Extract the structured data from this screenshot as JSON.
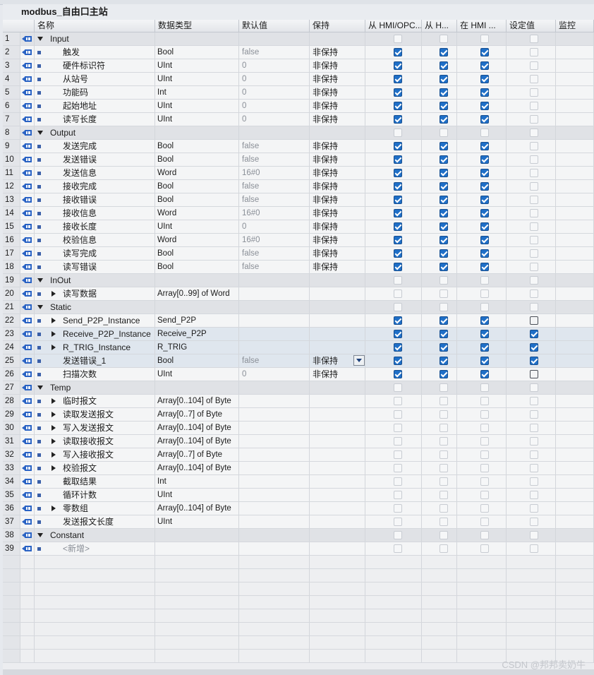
{
  "block_title": "modbus_自由口主站",
  "headers": [
    "名称",
    "数据类型",
    "默认值",
    "保持",
    "从 HMI/OPC...",
    "从 H...",
    "在 HMI ...",
    "设定值",
    "监控"
  ],
  "rows": [
    {
      "n": "1",
      "kind": "sec",
      "name": "Input",
      "caret": "down",
      "indent": 0,
      "type": "",
      "def": "",
      "ret": "",
      "cbs": [
        "off",
        "off",
        "off",
        "off"
      ]
    },
    {
      "n": "2",
      "kind": "norm",
      "name": "触发",
      "indent": 1,
      "type": "Bool",
      "def": "false",
      "ret": "非保持",
      "cbs": [
        "on",
        "on",
        "on",
        "off"
      ]
    },
    {
      "n": "3",
      "kind": "norm",
      "name": "硬件标识符",
      "indent": 1,
      "type": "UInt",
      "def": "0",
      "ret": "非保持",
      "cbs": [
        "on",
        "on",
        "on",
        "off"
      ]
    },
    {
      "n": "4",
      "kind": "norm",
      "name": "从站号",
      "indent": 1,
      "type": "UInt",
      "def": "0",
      "ret": "非保持",
      "cbs": [
        "on",
        "on",
        "on",
        "off"
      ]
    },
    {
      "n": "5",
      "kind": "norm",
      "name": "功能码",
      "indent": 1,
      "type": "Int",
      "def": "0",
      "ret": "非保持",
      "cbs": [
        "on",
        "on",
        "on",
        "off"
      ]
    },
    {
      "n": "6",
      "kind": "norm",
      "name": "起始地址",
      "indent": 1,
      "type": "UInt",
      "def": "0",
      "ret": "非保持",
      "cbs": [
        "on",
        "on",
        "on",
        "off"
      ]
    },
    {
      "n": "7",
      "kind": "norm",
      "name": "读写长度",
      "indent": 1,
      "type": "UInt",
      "def": "0",
      "ret": "非保持",
      "cbs": [
        "on",
        "on",
        "on",
        "off"
      ]
    },
    {
      "n": "8",
      "kind": "sec",
      "name": "Output",
      "caret": "down",
      "indent": 0,
      "type": "",
      "def": "",
      "ret": "",
      "cbs": [
        "off",
        "off",
        "off",
        "off"
      ]
    },
    {
      "n": "9",
      "kind": "norm",
      "name": "发送完成",
      "indent": 1,
      "type": "Bool",
      "def": "false",
      "ret": "非保持",
      "cbs": [
        "on",
        "on",
        "on",
        "off"
      ]
    },
    {
      "n": "10",
      "kind": "norm",
      "name": "发送错误",
      "indent": 1,
      "type": "Bool",
      "def": "false",
      "ret": "非保持",
      "cbs": [
        "on",
        "on",
        "on",
        "off"
      ]
    },
    {
      "n": "11",
      "kind": "norm",
      "name": "发送信息",
      "indent": 1,
      "type": "Word",
      "def": "16#0",
      "ret": "非保持",
      "cbs": [
        "on",
        "on",
        "on",
        "off"
      ]
    },
    {
      "n": "12",
      "kind": "norm",
      "name": "接收完成",
      "indent": 1,
      "type": "Bool",
      "def": "false",
      "ret": "非保持",
      "cbs": [
        "on",
        "on",
        "on",
        "off"
      ]
    },
    {
      "n": "13",
      "kind": "norm",
      "name": "接收错误",
      "indent": 1,
      "type": "Bool",
      "def": "false",
      "ret": "非保持",
      "cbs": [
        "on",
        "on",
        "on",
        "off"
      ]
    },
    {
      "n": "14",
      "kind": "norm",
      "name": "接收信息",
      "indent": 1,
      "type": "Word",
      "def": "16#0",
      "ret": "非保持",
      "cbs": [
        "on",
        "on",
        "on",
        "off"
      ]
    },
    {
      "n": "15",
      "kind": "norm",
      "name": "接收长度",
      "indent": 1,
      "type": "UInt",
      "def": "0",
      "ret": "非保持",
      "cbs": [
        "on",
        "on",
        "on",
        "off"
      ]
    },
    {
      "n": "16",
      "kind": "norm",
      "name": "校验信息",
      "indent": 1,
      "type": "Word",
      "def": "16#0",
      "ret": "非保持",
      "cbs": [
        "on",
        "on",
        "on",
        "off"
      ]
    },
    {
      "n": "17",
      "kind": "norm",
      "name": "读写完成",
      "indent": 1,
      "type": "Bool",
      "def": "false",
      "ret": "非保持",
      "cbs": [
        "on",
        "on",
        "on",
        "off"
      ]
    },
    {
      "n": "18",
      "kind": "norm",
      "name": "读写错误",
      "indent": 1,
      "type": "Bool",
      "def": "false",
      "ret": "非保持",
      "cbs": [
        "on",
        "on",
        "on",
        "off"
      ]
    },
    {
      "n": "19",
      "kind": "sec",
      "name": "InOut",
      "caret": "down",
      "indent": 0,
      "type": "",
      "def": "",
      "ret": "",
      "cbs": [
        "off",
        "off",
        "off",
        "off"
      ]
    },
    {
      "n": "20",
      "kind": "norm",
      "name": "读写数据",
      "caret": "right",
      "indent": 1,
      "type": "Array[0..99] of Word",
      "def": "",
      "ret": "",
      "cbs": [
        "off",
        "off",
        "off",
        "off"
      ]
    },
    {
      "n": "21",
      "kind": "sec",
      "name": "Static",
      "caret": "down",
      "indent": 0,
      "type": "",
      "def": "",
      "ret": "",
      "cbs": [
        "off",
        "off",
        "off",
        "off"
      ]
    },
    {
      "n": "22",
      "kind": "norm",
      "name": "Send_P2P_Instance",
      "caret": "right",
      "indent": 1,
      "type": "Send_P2P",
      "def": "",
      "ret": "",
      "cbs": [
        "on",
        "on",
        "on",
        "offdark"
      ]
    },
    {
      "n": "23",
      "kind": "sel",
      "name": "Receive_P2P_Instance",
      "caret": "right",
      "indent": 1,
      "type": "Receive_P2P",
      "def": "",
      "ret": "",
      "cbs": [
        "on",
        "on",
        "on",
        "on"
      ]
    },
    {
      "n": "24",
      "kind": "sel",
      "name": "R_TRIG_Instance",
      "caret": "right",
      "indent": 1,
      "type": "R_TRIG",
      "def": "",
      "ret": "",
      "cbs": [
        "on",
        "on",
        "on",
        "on"
      ]
    },
    {
      "n": "25",
      "kind": "sel",
      "name": "发送错误_1",
      "indent": 1,
      "type": "Bool",
      "def": "false",
      "ret": "非保持",
      "cbs": [
        "on",
        "on",
        "on",
        "on"
      ],
      "listbtn": true,
      "ddbtn": true
    },
    {
      "n": "26",
      "kind": "norm",
      "name": "扫描次数",
      "indent": 1,
      "type": "UInt",
      "def": "0",
      "ret": "非保持",
      "cbs": [
        "on",
        "on",
        "on",
        "offdark"
      ]
    },
    {
      "n": "27",
      "kind": "sec",
      "name": "Temp",
      "caret": "down",
      "indent": 0,
      "type": "",
      "def": "",
      "ret": "",
      "cbs": [
        "off",
        "off",
        "off",
        "off"
      ]
    },
    {
      "n": "28",
      "kind": "norm",
      "name": "临时报文",
      "caret": "right",
      "indent": 1,
      "type": "Array[0..104] of Byte",
      "def": "",
      "ret": "",
      "cbs": [
        "off",
        "off",
        "off",
        "off"
      ]
    },
    {
      "n": "29",
      "kind": "norm",
      "name": "读取发送报文",
      "caret": "right",
      "indent": 1,
      "type": "Array[0..7] of Byte",
      "def": "",
      "ret": "",
      "cbs": [
        "off",
        "off",
        "off",
        "off"
      ]
    },
    {
      "n": "30",
      "kind": "norm",
      "name": "写入发送报文",
      "caret": "right",
      "indent": 1,
      "type": "Array[0..104] of Byte",
      "def": "",
      "ret": "",
      "cbs": [
        "off",
        "off",
        "off",
        "off"
      ]
    },
    {
      "n": "31",
      "kind": "norm",
      "name": "读取接收报文",
      "caret": "right",
      "indent": 1,
      "type": "Array[0..104] of Byte",
      "def": "",
      "ret": "",
      "cbs": [
        "off",
        "off",
        "off",
        "off"
      ]
    },
    {
      "n": "32",
      "kind": "norm",
      "name": "写入接收报文",
      "caret": "right",
      "indent": 1,
      "type": "Array[0..7] of Byte",
      "def": "",
      "ret": "",
      "cbs": [
        "off",
        "off",
        "off",
        "off"
      ]
    },
    {
      "n": "33",
      "kind": "norm",
      "name": "校验报文",
      "caret": "right",
      "indent": 1,
      "type": "Array[0..104] of Byte",
      "def": "",
      "ret": "",
      "cbs": [
        "off",
        "off",
        "off",
        "off"
      ]
    },
    {
      "n": "34",
      "kind": "norm",
      "name": "截取结果",
      "indent": 1,
      "type": "Int",
      "def": "",
      "ret": "",
      "cbs": [
        "off",
        "off",
        "off",
        "off"
      ]
    },
    {
      "n": "35",
      "kind": "norm",
      "name": "循环计数",
      "indent": 1,
      "type": "UInt",
      "def": "",
      "ret": "",
      "cbs": [
        "off",
        "off",
        "off",
        "off"
      ]
    },
    {
      "n": "36",
      "kind": "norm",
      "name": "零数组",
      "caret": "right",
      "indent": 1,
      "type": "Array[0..104] of Byte",
      "def": "",
      "ret": "",
      "cbs": [
        "off",
        "off",
        "off",
        "off"
      ]
    },
    {
      "n": "37",
      "kind": "norm",
      "name": "发送报文长度",
      "indent": 1,
      "type": "UInt",
      "def": "",
      "ret": "",
      "cbs": [
        "off",
        "off",
        "off",
        "off"
      ]
    },
    {
      "n": "38",
      "kind": "sec",
      "name": "Constant",
      "caret": "down",
      "indent": 0,
      "type": "",
      "def": "",
      "ret": "",
      "cbs": [
        "off",
        "off",
        "off",
        "off"
      ]
    },
    {
      "n": "39",
      "kind": "norm",
      "name": "<新增>",
      "indent": 1,
      "newrow": true,
      "type": "",
      "def": "",
      "ret": "",
      "cbs": [
        "off",
        "off",
        "off",
        "off"
      ]
    }
  ],
  "watermark": "CSDN @邦邦卖奶牛",
  "colors": {
    "checked": "#1f6fc7",
    "section_bg": "#e0e2e6",
    "icon": "#2a63c4"
  }
}
